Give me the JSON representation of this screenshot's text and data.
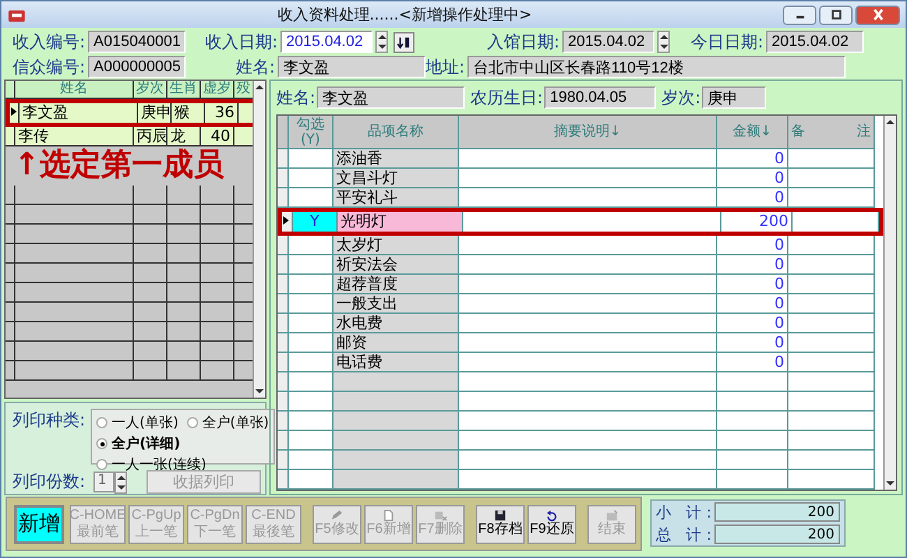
{
  "window": {
    "title": "收入资料处理......<新增操作处理中>"
  },
  "header": {
    "row_1": [
      {
        "kind": "readonly",
        "label": "收入编号:",
        "value": "A015040001"
      },
      {
        "kind": "date-input",
        "label": "收入日期:",
        "value": "2015.04.02"
      },
      {
        "kind": "date-readonly",
        "label": "入馆日期:",
        "value": "2015.04.02"
      },
      {
        "kind": "readonly",
        "label": "今日日期:",
        "value": "2015.04.02"
      }
    ],
    "row_2": [
      {
        "kind": "readonly",
        "label": "信众编号:",
        "value": "A000000005"
      },
      {
        "kind": "readonly",
        "label": "姓名:",
        "value": "李文盈"
      },
      {
        "kind": "readonly",
        "label": "地址:",
        "value": "台北市中山区长春路110号12楼"
      }
    ]
  },
  "members": {
    "columns": [
      "姓名",
      "岁次",
      "生肖",
      "虚岁",
      "殁"
    ],
    "rows": [
      {
        "selected": true,
        "cells": [
          "李文盈",
          "庚申",
          "猴",
          "36"
        ]
      },
      {
        "selected": false,
        "cells": [
          "李传",
          "丙辰",
          "龙",
          "40"
        ]
      }
    ]
  },
  "annotation": "↑选定第一成员",
  "print_options": {
    "type_label": "列印种类:",
    "choices": [
      {
        "label": "一人(单张)",
        "selected": false
      },
      {
        "label": "全户(单张)",
        "selected": false
      },
      {
        "label": "全户(详细)",
        "selected": true
      },
      {
        "label": "一人一张(连续)",
        "selected": false
      }
    ],
    "copies_label": "列印份数:",
    "copies": "1",
    "print_button": {
      "label": "收据列印",
      "disabled": true
    }
  },
  "detail": {
    "fields": [
      {
        "label": "姓名:",
        "value": "李文盈"
      },
      {
        "label": "农历生日:",
        "value": "1980.04.05"
      },
      {
        "label": "岁次:",
        "value": "庚申"
      }
    ],
    "columns": [
      "勾选(Y)",
      "品项名称",
      "摘要说明↓",
      "金额↓",
      "备 注"
    ],
    "rows": [
      {
        "selected": false,
        "item": "添油香",
        "amount": "0"
      },
      {
        "selected": false,
        "item": "文昌斗灯",
        "amount": "0"
      },
      {
        "selected": false,
        "item": "平安礼斗",
        "amount": "0"
      },
      {
        "selected": true,
        "pick": "Y",
        "item": "光明灯",
        "amount": "200"
      },
      {
        "selected": false,
        "item": "太岁灯",
        "amount": "0"
      },
      {
        "selected": false,
        "item": "祈安法会",
        "amount": "0"
      },
      {
        "selected": false,
        "item": "超荐普度",
        "amount": "0"
      },
      {
        "selected": false,
        "item": "一般支出",
        "amount": "0"
      },
      {
        "selected": false,
        "item": "水电费",
        "amount": "0"
      },
      {
        "selected": false,
        "item": "邮资",
        "amount": "0"
      },
      {
        "selected": false,
        "item": "电话费",
        "amount": "0"
      }
    ]
  },
  "toolbar": [
    {
      "kind": "big",
      "label": "新增",
      "disabled": false
    },
    {
      "kind": "nav",
      "shortcut": "C-HOME",
      "label": "最前笔",
      "disabled": true
    },
    {
      "kind": "nav",
      "shortcut": "C-PgUp",
      "label": "上一笔",
      "disabled": true
    },
    {
      "kind": "nav",
      "shortcut": "C-PgDn",
      "label": "下一笔",
      "disabled": true
    },
    {
      "kind": "nav",
      "shortcut": "C-END",
      "label": "最後笔",
      "disabled": true
    },
    {
      "kind": "func",
      "label": "F5修改",
      "disabled": true
    },
    {
      "kind": "func",
      "label": "F6新增",
      "disabled": true
    },
    {
      "kind": "func",
      "label": "F7删除",
      "disabled": true
    },
    {
      "kind": "func",
      "label": "F8存档",
      "disabled": false
    },
    {
      "kind": "func",
      "label": "F9还原",
      "disabled": false
    },
    {
      "kind": "func",
      "label": "结束",
      "disabled": true
    }
  ],
  "totals": [
    {
      "label": "小 计:",
      "value": "200"
    },
    {
      "label": "总 计:",
      "value": "200"
    }
  ]
}
